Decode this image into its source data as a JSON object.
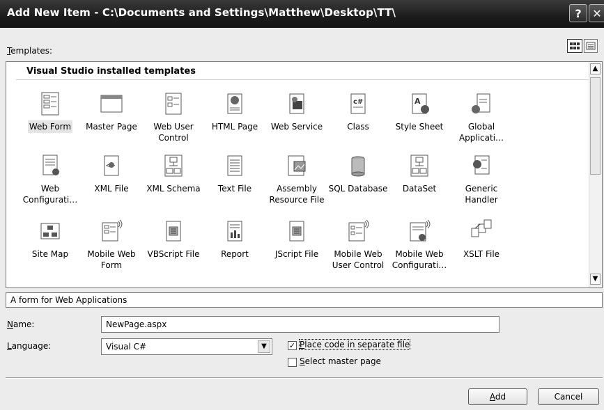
{
  "window": {
    "title": "Add New Item - C:\\Documents and Settings\\Matthew\\Desktop\\TT\\",
    "help_glyph": "?",
    "close_glyph": "✕"
  },
  "templates_label": {
    "pre": "",
    "accel": "T",
    "post": "emplates:"
  },
  "templates": {
    "header": "Visual Studio installed templates",
    "items": [
      {
        "label": "Web Form",
        "icon": "web-form-icon",
        "selected": true
      },
      {
        "label": "Master Page",
        "icon": "master-page-icon"
      },
      {
        "label": "Web User Control",
        "icon": "web-user-control-icon"
      },
      {
        "label": "HTML Page",
        "icon": "html-page-icon"
      },
      {
        "label": "Web Service",
        "icon": "web-service-icon"
      },
      {
        "label": "Class",
        "icon": "class-icon"
      },
      {
        "label": "Style Sheet",
        "icon": "style-sheet-icon"
      },
      {
        "label": "Global Applicati…",
        "icon": "global-application-icon"
      },
      {
        "label": "Web Configurati…",
        "icon": "web-configuration-icon"
      },
      {
        "label": "XML File",
        "icon": "xml-file-icon"
      },
      {
        "label": "XML Schema",
        "icon": "xml-schema-icon"
      },
      {
        "label": "Text File",
        "icon": "text-file-icon"
      },
      {
        "label": "Assembly Resource File",
        "icon": "assembly-resource-icon"
      },
      {
        "label": "SQL Database",
        "icon": "sql-database-icon"
      },
      {
        "label": "DataSet",
        "icon": "dataset-icon"
      },
      {
        "label": "Generic Handler",
        "icon": "generic-handler-icon"
      },
      {
        "label": "Site Map",
        "icon": "site-map-icon"
      },
      {
        "label": "Mobile Web Form",
        "icon": "mobile-web-form-icon"
      },
      {
        "label": "VBScript File",
        "icon": "vbscript-file-icon"
      },
      {
        "label": "Report",
        "icon": "report-icon"
      },
      {
        "label": "JScript File",
        "icon": "jscript-file-icon"
      },
      {
        "label": "Mobile Web User Control",
        "icon": "mobile-web-user-control-icon"
      },
      {
        "label": "Mobile Web Configurati…",
        "icon": "mobile-web-configuration-icon"
      },
      {
        "label": "XSLT File",
        "icon": "xslt-file-icon"
      }
    ]
  },
  "description": "A form for Web Applications",
  "name_label": {
    "pre": "",
    "accel": "N",
    "post": "ame:"
  },
  "name_value": "NewPage.aspx",
  "language_label": {
    "pre": "",
    "accel": "L",
    "post": "anguage:"
  },
  "language_value": "Visual C#",
  "options": {
    "separate_code": {
      "pre": "",
      "accel": "P",
      "post": "lace code in separate file",
      "checked": true
    },
    "master_page": {
      "pre": "",
      "accel": "S",
      "post": "elect master page",
      "checked": false
    }
  },
  "buttons": {
    "add": {
      "pre": "",
      "accel": "A",
      "post": "dd"
    },
    "cancel": "Cancel"
  },
  "colors": {
    "titlebar": "#1c1c1c",
    "panel": "#ffffff",
    "dialog": "#ececec"
  }
}
